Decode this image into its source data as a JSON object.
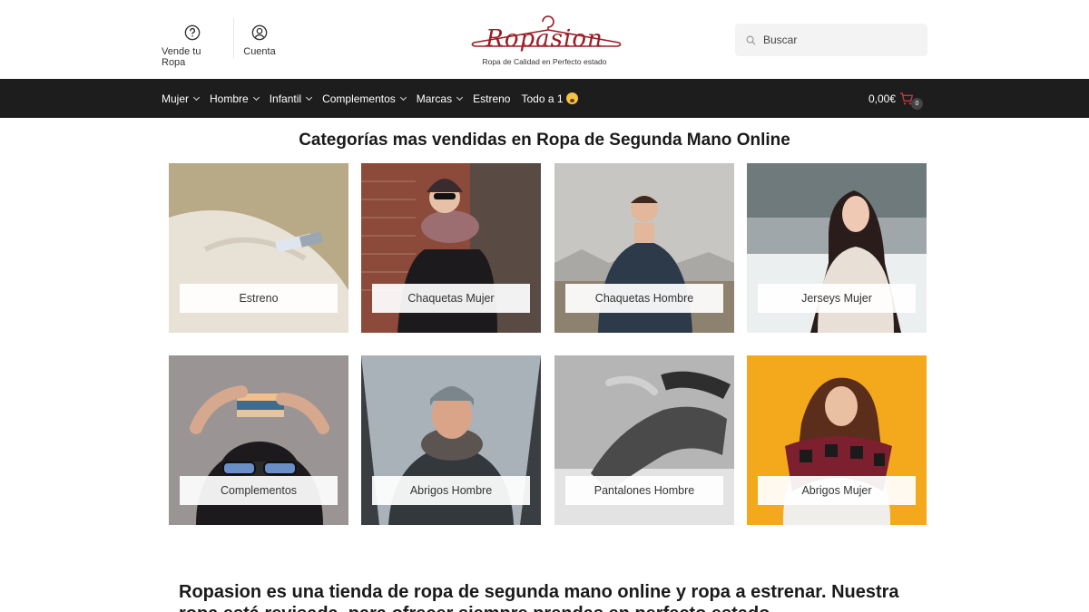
{
  "header": {
    "sell_label": "Vende tu Ropa",
    "account_label": "Cuenta",
    "logo_text": "Ropasion",
    "logo_tagline": "Ropa de Calidad en Perfecto estado",
    "search_placeholder": "Buscar"
  },
  "nav": {
    "items": [
      {
        "label": "Mujer",
        "dropdown": true
      },
      {
        "label": "Hombre",
        "dropdown": true
      },
      {
        "label": "Infantil",
        "dropdown": true
      },
      {
        "label": "Complementos",
        "dropdown": true
      },
      {
        "label": "Marcas",
        "dropdown": true
      },
      {
        "label": "Estreno",
        "dropdown": false
      },
      {
        "label": "Todo a 1",
        "dropdown": false,
        "icon": "scream-emoji-icon"
      }
    ],
    "cart_total": "0,00€",
    "cart_count": "0"
  },
  "main": {
    "title": "Categorías mas vendidas en Ropa de Segunda Mano Online",
    "categories": [
      {
        "label": "Estreno"
      },
      {
        "label": "Chaquetas Mujer"
      },
      {
        "label": "Chaquetas Hombre"
      },
      {
        "label": "Jerseys Mujer"
      },
      {
        "label": "Complementos"
      },
      {
        "label": "Abrigos Hombre"
      },
      {
        "label": "Pantalones Hombre"
      },
      {
        "label": "Abrigos Mujer"
      }
    ],
    "intro_text": "Ropasion es una tienda de ropa de segunda mano online y ropa a estrenar. Nuestra ropa está revisada, para ofrecer siempre prendas en perfecto estado."
  },
  "colors": {
    "brand": "#9c1c26",
    "navbar": "#1d1d1d",
    "search_bg": "#f3f3f3"
  }
}
